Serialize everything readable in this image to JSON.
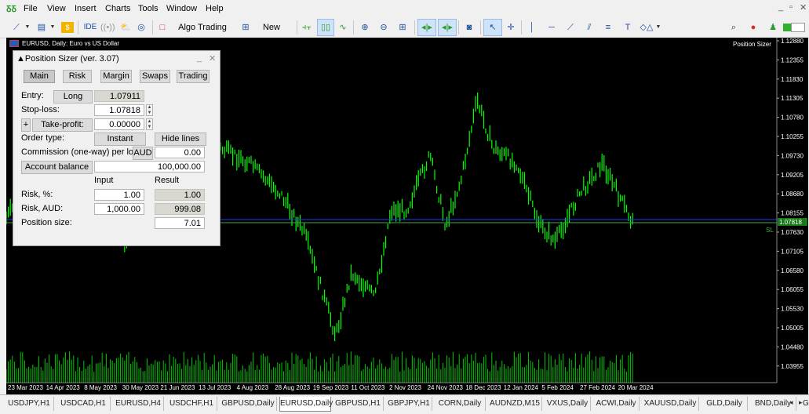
{
  "app": {
    "logo": "ꝽꝽ"
  },
  "menu": [
    "File",
    "View",
    "Insert",
    "Charts",
    "Tools",
    "Window",
    "Help"
  ],
  "window_controls": [
    "_",
    "▫",
    "✕"
  ],
  "toolbar": {
    "ide_label": "IDE",
    "algo_trading_label": "Algo Trading",
    "new_order_label": "New Order"
  },
  "chart": {
    "title": "EURUSD, Daily:  Euro vs US Dollar",
    "indicator_label": "Position Sizer",
    "bid_price_label": "1.07818",
    "sl_label": "SL",
    "price_axis": [
      "1.12880",
      "1.12355",
      "1.11830",
      "1.11305",
      "1.10780",
      "1.10255",
      "1.09730",
      "1.09205",
      "1.08680",
      "1.08155",
      "1.07630",
      "1.07105",
      "1.06580",
      "1.06055",
      "1.05530",
      "1.05005",
      "1.04480",
      "1.03955"
    ],
    "time_axis": [
      "23 Mar 2023",
      "14 Apr 2023",
      "8 May 2023",
      "30 May 2023",
      "21 Jun 2023",
      "13 Jul 2023",
      "4 Aug 2023",
      "28 Aug 2023",
      "19 Sep 2023",
      "11 Oct 2023",
      "2 Nov 2023",
      "24 Nov 2023",
      "18 Dec 2023",
      "12 Jan 2024",
      "5 Feb 2024",
      "27 Feb 2024",
      "20 Mar 2024"
    ],
    "colors": {
      "background": "#000000",
      "bars": "#00ff00",
      "volume": "#00c800",
      "entry_line": "#1e3cff",
      "sl_line": "#3aaa3a"
    }
  },
  "panel": {
    "title": "▲Position Sizer (ver. 3.07)",
    "minimize": "_",
    "close": "✕",
    "tabs": [
      "Main",
      "Risk",
      "Margin",
      "Swaps",
      "Trading"
    ],
    "entry_label": "Entry:",
    "direction_button": "Long",
    "entry_value": "1.07911",
    "stoploss_label": "Stop-loss:",
    "stoploss_value": "1.07818",
    "tp_plus": "+",
    "tp_button": "Take-profit:",
    "tp_value": "0.00000",
    "order_type_label": "Order type:",
    "order_type_button": "Instant",
    "hide_lines_button": "Hide lines",
    "commission_label": "Commission (one-way) per lot:",
    "commission_currency": "AUD",
    "commission_value": "0.00",
    "account_balance_button": "Account balance",
    "account_balance_value": "100,000.00",
    "input_header": "Input",
    "result_header": "Result",
    "risk_pct_label": "Risk, %:",
    "risk_pct_input": "1.00",
    "risk_pct_result": "1.00",
    "risk_aud_label": "Risk, AUD:",
    "risk_aud_input": "1,000.00",
    "risk_aud_result": "999.08",
    "position_size_label": "Position size:",
    "position_size_value": "7.01"
  },
  "tabs": [
    "USDJPY,H1",
    "USDCAD,H1",
    "EURUSD,H4",
    "USDCHF,H1",
    "GBPUSD,Daily",
    "EURUSD,Daily",
    "GBPUSD,H1",
    "GBPJPY,H1",
    "CORN,Daily",
    "AUDNZD,M15",
    "VXUS,Daily",
    "ACWI,Daily",
    "XAUUSD,Daily",
    "GLD,Daily",
    "BND,Daily",
    "Gl"
  ],
  "active_tab": 5
}
